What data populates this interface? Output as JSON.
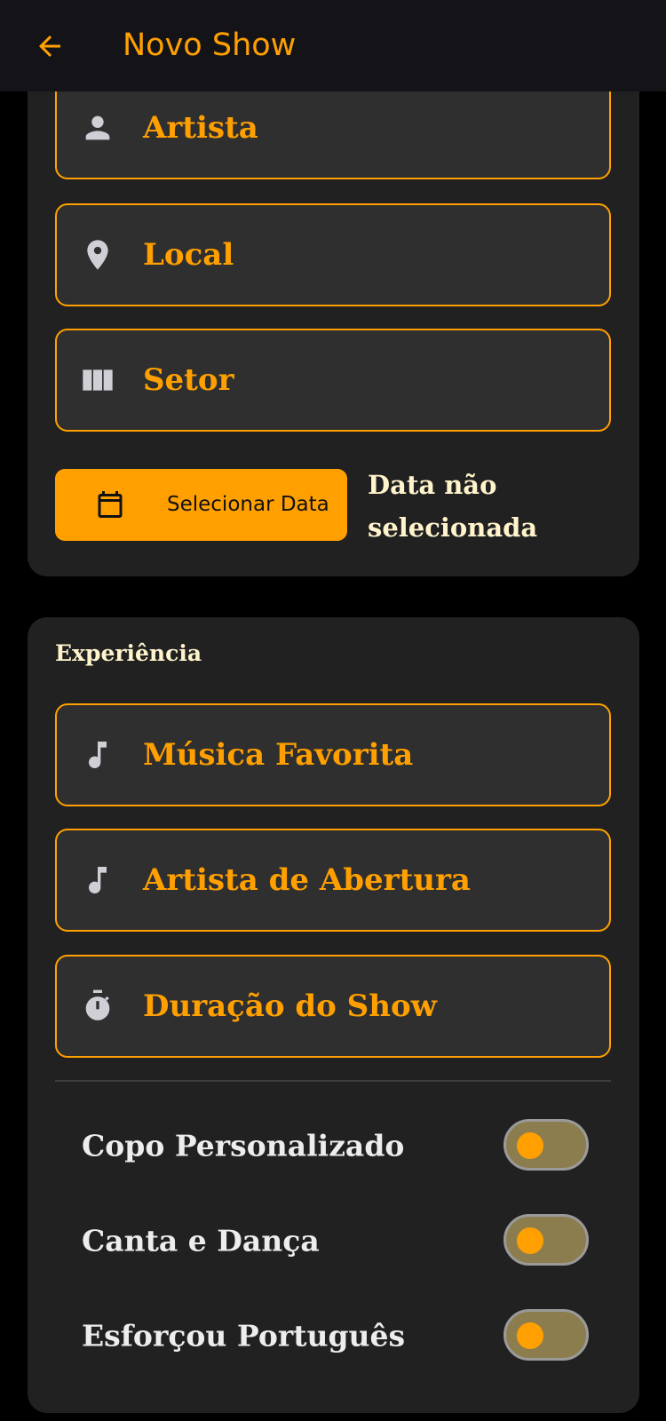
{
  "appbar": {
    "title": "Novo Show",
    "back_icon": "arrow-back-icon"
  },
  "colors": {
    "accent": "#FFA000",
    "background": "#000000",
    "card": "#212121",
    "field_fill": "#2F2F2F",
    "icon_gray": "#D0CFD6",
    "cream_text": "#FFF4CC"
  },
  "show_info": {
    "fields": [
      {
        "label": "Artista",
        "icon": "person-icon"
      },
      {
        "label": "Local",
        "icon": "location-pin-icon"
      },
      {
        "label": "Setor",
        "icon": "view-column-icon"
      }
    ],
    "date_button": {
      "label": "Selecionar Data",
      "icon": "calendar-icon"
    },
    "date_status": "Data não selecionada"
  },
  "experience": {
    "title": "Experiência",
    "fields": [
      {
        "label": "Música Favorita",
        "icon": "music-note-icon"
      },
      {
        "label": "Artista de Abertura",
        "icon": "music-note-icon"
      },
      {
        "label": "Duração do Show",
        "icon": "timer-icon"
      }
    ],
    "toggles": [
      {
        "label": "Copo Personalizado",
        "checked": false
      },
      {
        "label": "Canta e Dança",
        "checked": false
      },
      {
        "label": "Esforçou Português",
        "checked": false
      }
    ]
  }
}
